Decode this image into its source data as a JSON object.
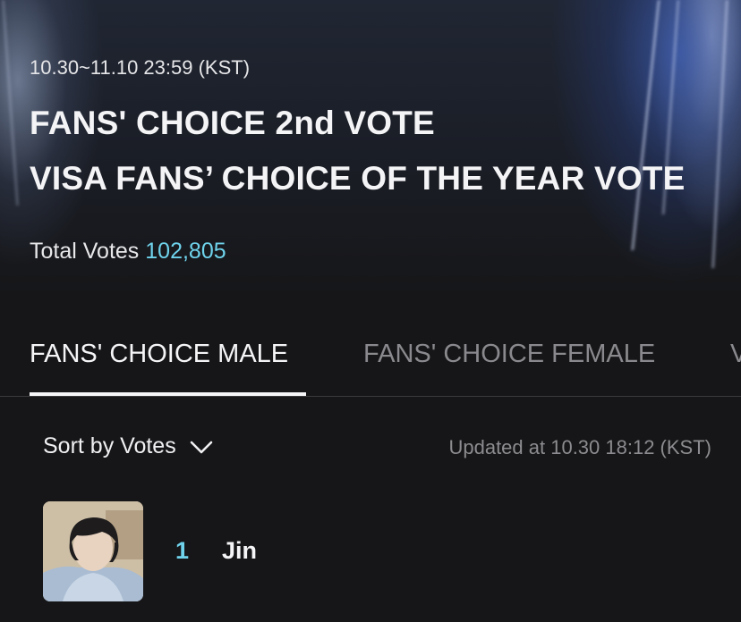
{
  "header": {
    "period": "10.30~11.10 23:59 (KST)",
    "title_line1": "FANS' CHOICE 2nd VOTE",
    "title_line2": "VISA FANS’ CHOICE OF THE YEAR VOTE",
    "total_label": "Total Votes",
    "total_value": "102,805"
  },
  "tabs": [
    {
      "label": "FANS' CHOICE MALE",
      "active": true
    },
    {
      "label": "FANS' CHOICE FEMALE",
      "active": false
    },
    {
      "label": "V",
      "active": false
    }
  ],
  "list": {
    "sort_label": "Sort by Votes",
    "sort_icon": "chevron-down-icon",
    "updated_text": "Updated at 10.30 18:12 (KST)",
    "items": [
      {
        "rank": "1",
        "name": "Jin",
        "thumbnail": "artist-photo"
      }
    ]
  },
  "colors": {
    "accent": "#6fd3ec",
    "background": "#161618",
    "inactive_tab": "#8a8a8e"
  }
}
